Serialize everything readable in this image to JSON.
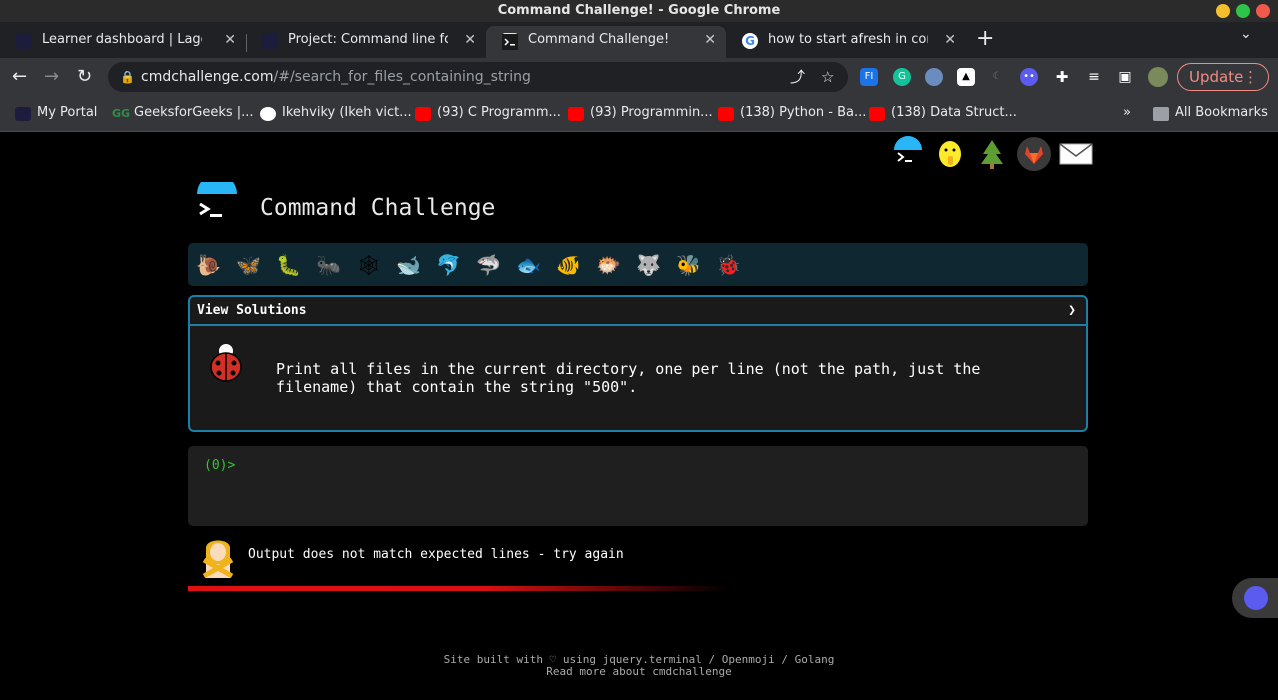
{
  "window": {
    "title": "Command Challenge! - Google Chrome"
  },
  "tabs": [
    {
      "label": "Learner dashboard | Lagos In",
      "favicon": "alx-icon"
    },
    {
      "label": "Project: Command line for the",
      "favicon": "alx-icon"
    },
    {
      "label": "Command Challenge!",
      "favicon": "terminal-icon",
      "active": true
    },
    {
      "label": "how to start afresh in comma",
      "favicon": "google-icon"
    }
  ],
  "toolbar": {
    "url_host": "cmdchallenge.com",
    "url_path": "/#/search_for_files_containing_string",
    "update_label": "Update"
  },
  "bookmarks": [
    {
      "label": "My Portal",
      "icon": "portal-icon"
    },
    {
      "label": "GeeksforGeeks |...",
      "icon": "gfg-icon"
    },
    {
      "label": "Ikehviky (Ikeh vict...",
      "icon": "github-icon"
    },
    {
      "label": "(93) C Programm...",
      "icon": "youtube-icon"
    },
    {
      "label": "(93) Programmin...",
      "icon": "youtube-icon"
    },
    {
      "label": "(138) Python - Ba...",
      "icon": "youtube-icon"
    },
    {
      "label": "(138) Data Struct...",
      "icon": "youtube-icon"
    }
  ],
  "bookmarks_overflow": "»",
  "all_bookmarks": "All Bookmarks",
  "site": {
    "title": "Command Challenge",
    "view_solutions": "View Solutions",
    "chevron": "❯",
    "challenge_line1": "Print all files in the current directory, one per line (not the path, just the",
    "challenge_line2": "filename) that contain the string \"500\".",
    "terminal_prompt": "(0)>",
    "result_message": "Output does not match expected lines - try again",
    "footer_line1": "Site built with ♡ using jquery.terminal / Openmoji / Golang",
    "footer_line2": "Read more about cmdchallenge"
  },
  "level_icons": [
    "snail",
    "butterfly",
    "caterpillar",
    "ant",
    "spider-web",
    "whale",
    "dolphin",
    "shark",
    "fish",
    "tropical-fish",
    "pufferfish",
    "wolf",
    "bee",
    "ladybug"
  ],
  "top_icons": [
    "terminal-logo",
    "shushing-face",
    "tree",
    "gitlab",
    "envelope"
  ],
  "colors": {
    "accent": "#1d7fa8",
    "prompt_green": "#34c934",
    "error_red": "#e01010",
    "update": "#f28b82"
  }
}
